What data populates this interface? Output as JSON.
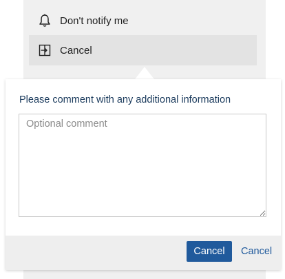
{
  "menu": {
    "items": [
      {
        "label": "Don't notify me",
        "icon": "bell-icon"
      },
      {
        "label": "Cancel",
        "icon": "exit-door-icon"
      }
    ]
  },
  "popover": {
    "prompt": "Please comment with any additional information",
    "comment": {
      "value": "",
      "placeholder": "Optional comment"
    },
    "buttons": {
      "primary_label": "Cancel",
      "secondary_label": "Cancel"
    }
  },
  "colors": {
    "primary": "#205a9c",
    "menu_bg": "#f0f0f0",
    "menu_selected_bg": "#e3e3e3",
    "footer_bg": "#eeeeee",
    "prompt_text": "#1a3a5c"
  }
}
